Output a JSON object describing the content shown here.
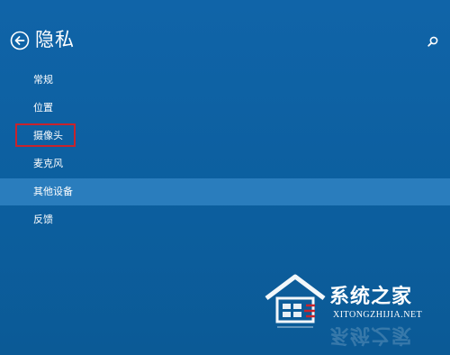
{
  "header": {
    "title": "隐私",
    "back_icon": "back-arrow-icon",
    "search_icon": "search-icon"
  },
  "nav": {
    "items": [
      {
        "label": "常规"
      },
      {
        "label": "位置"
      },
      {
        "label": "摄像头"
      },
      {
        "label": "麦克风"
      },
      {
        "label": "其他设备"
      },
      {
        "label": "反馈"
      }
    ],
    "selected_label": "其他设备",
    "annotated_label": "摄像头"
  },
  "colors": {
    "background": "#0e64a6",
    "selected_row": "#2a7dbd",
    "annotation_border": "#c8232c",
    "text": "#ffffff"
  },
  "watermark": {
    "brand": "系统之家",
    "url": "XITONGZHIJIA.NET"
  }
}
